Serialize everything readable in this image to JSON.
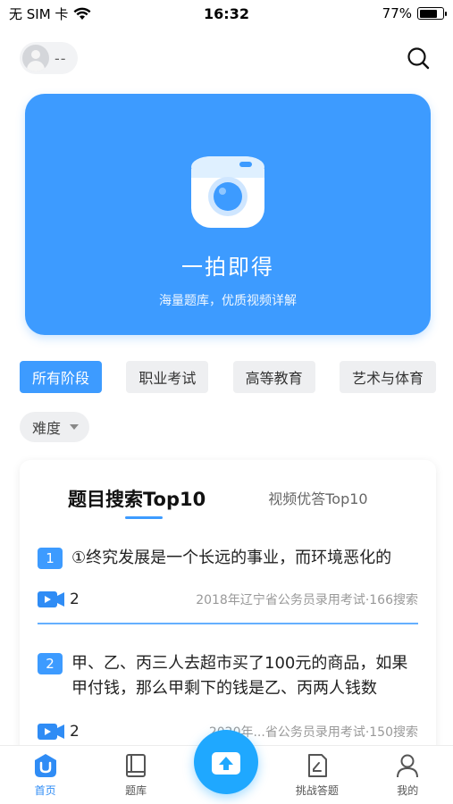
{
  "status_bar": {
    "carrier": "无 SIM 卡",
    "time": "16:32",
    "battery": "77%",
    "battery_level": 0.77
  },
  "header": {
    "user_name": "--"
  },
  "hero": {
    "title": "一拍即得",
    "subtitle": "海量题库，优质视频详解",
    "icon": "camera-icon"
  },
  "filters": {
    "chips": [
      "所有阶段",
      "职业考试",
      "高等教育",
      "艺术与体育"
    ],
    "difficulty_label": "难度"
  },
  "card": {
    "tabs": [
      "题目搜索Top10",
      "视频优答Top10"
    ],
    "questions": [
      {
        "rank": "1",
        "text": "①终究发展是一个长远的事业，而环境恶化的",
        "video_count": "2",
        "meta": "2018年辽宁省公务员录用考试·166搜索"
      },
      {
        "rank": "2",
        "text": "甲、乙、丙三人去超市买了100元的商品，如果甲付钱，那么甲剩下的钱是乙、丙两人钱数",
        "video_count": "2",
        "meta": "2020年...省公务员录用考试·150搜索"
      }
    ]
  },
  "tab_bar": {
    "items": [
      {
        "label": "首页",
        "icon": "home-icon"
      },
      {
        "label": "题库",
        "icon": "book-icon"
      },
      {
        "label": "挑战答题",
        "icon": "challenge-icon"
      },
      {
        "label": "我的",
        "icon": "profile-icon"
      }
    ]
  },
  "colors": {
    "accent": "#3d9bff",
    "center_button": "#1fa8ff"
  }
}
